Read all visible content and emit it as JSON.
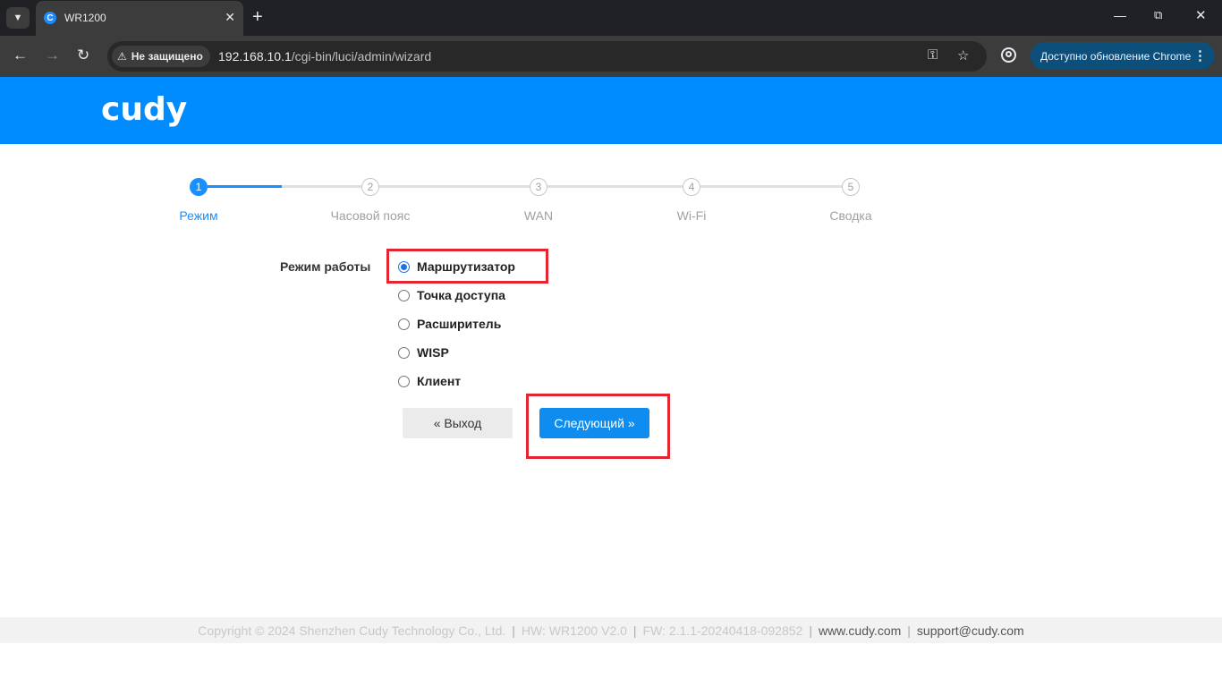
{
  "browser": {
    "tab_title": "WR1200",
    "tab_favicon_letter": "C",
    "security_label": "Не защищено",
    "url_host": "192.168.10.1",
    "url_path": "/cgi-bin/luci/admin/wizard",
    "update_label": "Доступно обновление Chrome",
    "accent": "#0b4f7a"
  },
  "header": {
    "logo": "cudy",
    "color": "#008cff"
  },
  "wizard": {
    "steps": [
      {
        "number": "1",
        "label": "Режим",
        "active": true
      },
      {
        "number": "2",
        "label": "Часовой пояс",
        "active": false
      },
      {
        "number": "3",
        "label": "WAN",
        "active": false
      },
      {
        "number": "4",
        "label": "Wi-Fi",
        "active": false
      },
      {
        "number": "5",
        "label": "Сводка",
        "active": false
      }
    ],
    "mode_label": "Режим работы",
    "modes": [
      {
        "label": "Маршрутизатор",
        "checked": true
      },
      {
        "label": "Точка доступа",
        "checked": false
      },
      {
        "label": "Расширитель",
        "checked": false
      },
      {
        "label": "WISP",
        "checked": false
      },
      {
        "label": "Клиент",
        "checked": false
      }
    ],
    "exit_label": "« Выход",
    "next_label": "Следующий »"
  },
  "footer": {
    "copyright": "Copyright © 2024 Shenzhen Cudy Technology Co., Ltd.",
    "hw": "HW: WR1200 V2.0",
    "fw": "FW: 2.1.1-20240418-092852",
    "website": "www.cudy.com",
    "email": "support@cudy.com",
    "separator": "|"
  }
}
